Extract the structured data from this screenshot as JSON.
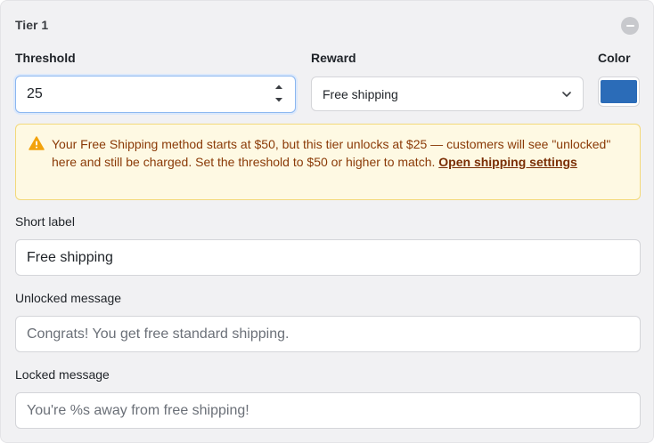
{
  "tier": {
    "title": "Tier 1"
  },
  "threshold": {
    "label": "Threshold",
    "value": "25"
  },
  "reward": {
    "label": "Reward",
    "selected": "Free shipping"
  },
  "color": {
    "label": "Color",
    "value": "#2b6cb8"
  },
  "warning": {
    "text": "Your Free Shipping method starts at $50, but this tier unlocks at $25 — customers will see \"unlocked\" here and still be charged. Set the threshold to $50 or higher to match.",
    "link": "Open shipping settings"
  },
  "short_label": {
    "label": "Short label",
    "value": "Free shipping"
  },
  "unlocked_message": {
    "label": "Unlocked message",
    "placeholder": "Congrats! You get free standard shipping."
  },
  "locked_message": {
    "label": "Locked message",
    "placeholder": "You're %s away from free shipping!"
  },
  "icons": {
    "remove": "minus-circle-icon",
    "stepper": "stepper-arrows-icon",
    "dropdown": "chevron-down-icon",
    "warning": "warning-triangle-icon"
  }
}
